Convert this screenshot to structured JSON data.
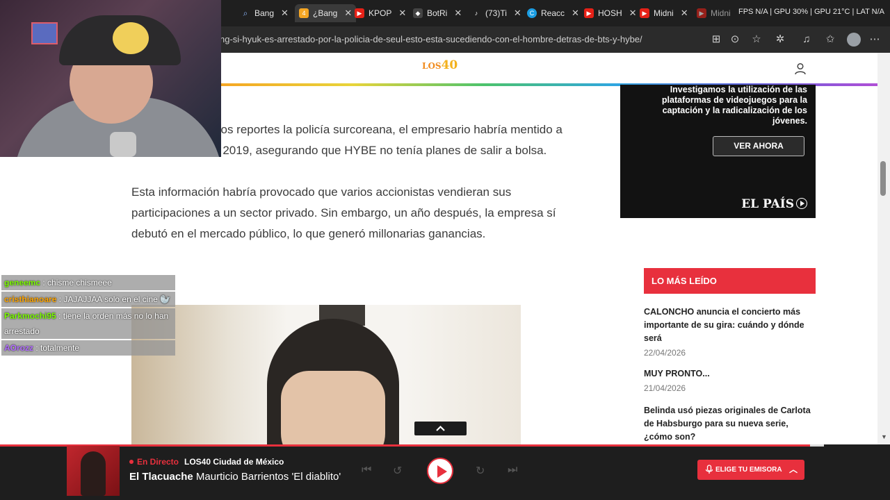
{
  "browser": {
    "tabs": [
      {
        "label": "",
        "icon": "blank"
      },
      {
        "label": "Bang",
        "icon": "search-icon"
      },
      {
        "label": "¿Bang",
        "icon": "los40-favicon",
        "active": true
      },
      {
        "label": "KPOP",
        "icon": "youtube-icon"
      },
      {
        "label": "BotRi",
        "icon": "botrix-icon"
      },
      {
        "label": "(73)Ti",
        "icon": "tiktok-icon"
      },
      {
        "label": "Reacc",
        "icon": "edge-icon"
      },
      {
        "label": "HOSH",
        "icon": "youtube-icon"
      },
      {
        "label": "Midni",
        "icon": "youtube-icon"
      },
      {
        "label": "Midni",
        "icon": "youtube-icon"
      }
    ],
    "system_info": "FPS N/A | GPU 30% | GPU 21°C | LAT N/A",
    "url": "ng-si-hyuk-es-arrestado-por-la-policia-de-seul-esto-esta-sucediendo-con-el-hombre-detras-de-bts-y-hybe/"
  },
  "site": {
    "logo_main": "LOS",
    "logo_accent": "40"
  },
  "article": {
    "paragraphs": [
      "Según los primeros reportes la policía surcoreana, el empresario habría mentido a inversionistas en 2019, asegurando que HYBE no tenía planes de salir a bolsa.",
      "Esta información habría provocado que varios accionistas vendieran sus participaciones a un sector privado. Sin embargo, un año después, la empresa sí debutó en el mercado público, lo que generó millonarias ganancias."
    ]
  },
  "ad": {
    "text": "Investigamos la utilización de las plataformas de videojuegos para la captación y la radicalización de los jóvenes.",
    "button": "VER AHORA",
    "brand": "EL PAÍS"
  },
  "most_read": {
    "heading": "LO MÁS LEÍDO",
    "items": [
      {
        "title": "CALONCHO anuncia el concierto más importante de su gira: cuándo y dónde será",
        "date": "22/04/2026"
      },
      {
        "title": "MUY PRONTO...",
        "date": "21/04/2026"
      },
      {
        "title": "Belinda usó piezas originales de Carlota de Habsburgo para su nueva serie, ¿cómo son?",
        "date": ""
      }
    ]
  },
  "chat": [
    {
      "user": "geneemc",
      "color": "#7CFC00",
      "text": ": chisme chismeee"
    },
    {
      "user": "cristhianoare",
      "color": "#FFA500",
      "text": ": JAJAJJAA solo en el cine 🦭"
    },
    {
      "user": "Parkmochi95",
      "color": "#7CFC00",
      "text": ": tiene la orden más no lo han arrestado"
    },
    {
      "user": "AOrozz",
      "color": "#B26BFF",
      "text": ": totalmente"
    }
  ],
  "player": {
    "live_label": "En Directo",
    "station": "LOS40 Ciudad de México",
    "show_name": "El Tlacuache",
    "host": "Maurticio Barrientos 'El diablito'",
    "choose_station": "ELIGE TU EMISORA",
    "progress": 0.91
  },
  "colors": {
    "accent": "#e8303d",
    "logo": "#f08a1c"
  }
}
